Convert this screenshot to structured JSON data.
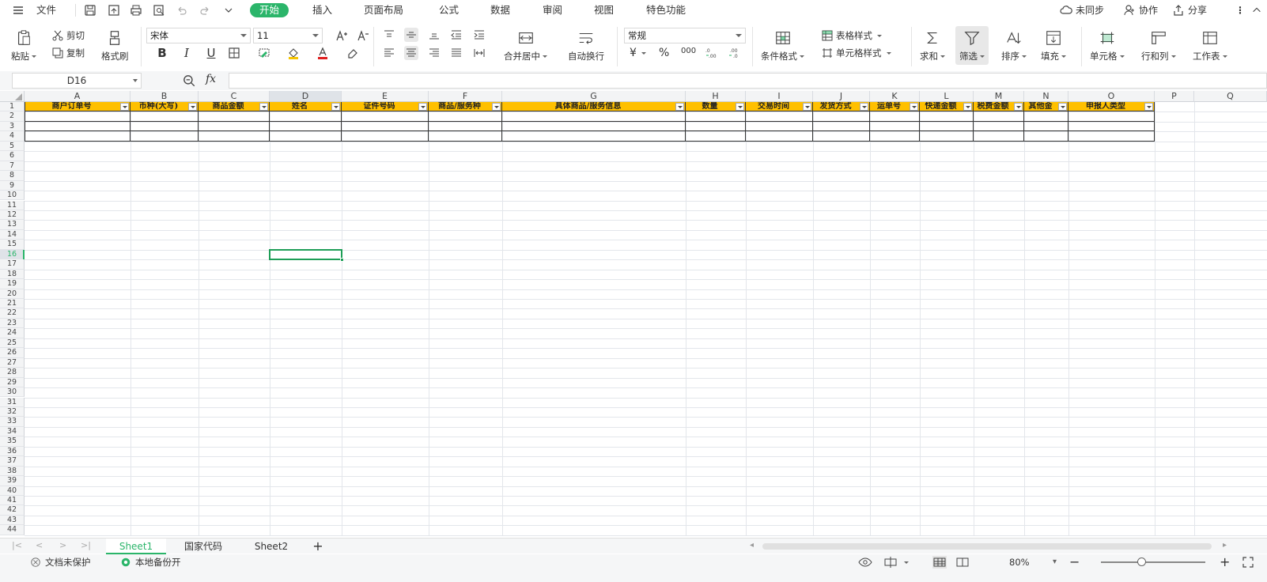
{
  "menubar": {
    "file_label": "文件",
    "tabs": [
      {
        "label": "开始",
        "active": true
      },
      {
        "label": "插入"
      },
      {
        "label": "页面布局"
      },
      {
        "label": "公式"
      },
      {
        "label": "数据"
      },
      {
        "label": "审阅"
      },
      {
        "label": "视图"
      },
      {
        "label": "特色功能"
      }
    ],
    "sync_label": "未同步",
    "collab_label": "协作",
    "share_label": "分享"
  },
  "ribbon": {
    "paste": "粘贴",
    "cut": "剪切",
    "copy": "复制",
    "format_painter": "格式刷",
    "font_name": "宋体",
    "font_size": "11",
    "merge_center": "合并居中",
    "wrap_text": "自动换行",
    "number_format": "常规",
    "cond_format": "条件格式",
    "table_style": "表格样式",
    "cell_style": "单元格样式",
    "sum": "求和",
    "filter": "筛选",
    "sort": "排序",
    "fill": "填充",
    "cell": "单元格",
    "row_col": "行和列",
    "worksheet": "工作表",
    "bold": "B",
    "italic": "I",
    "underline": "U",
    "currency": "¥",
    "percent": "%",
    "thousands": "000"
  },
  "formula_bar": {
    "name_box": "D16",
    "fx": "fx",
    "content": ""
  },
  "grid": {
    "columns": [
      "A",
      "B",
      "C",
      "D",
      "E",
      "F",
      "G",
      "H",
      "I",
      "J",
      "K",
      "L",
      "M",
      "N",
      "O",
      "P",
      "Q"
    ],
    "selected_column": "D",
    "selected_row": 16,
    "row_count": 44,
    "headers": [
      "商户订单号",
      "币种(大写)",
      "商品金额",
      "姓名",
      "证件号码",
      "商品/服务种类",
      "具体商品/服务信息",
      "数量",
      "交易时间",
      "发货方式",
      "运单号",
      "快递金额",
      "税费金额",
      "其他金",
      "申报人类型"
    ],
    "header_row_display": [
      "商户订单号",
      "币种(大写)",
      "商品金额",
      "姓名",
      "证件号码",
      "商品/服务种",
      "具体商品/服务信息",
      "数量",
      "交易时间",
      "发货方式",
      "运单号",
      "快递金额",
      "税费金额",
      "其他金",
      "申报人类型"
    ]
  },
  "sheets": {
    "tabs": [
      {
        "label": "Sheet1",
        "active": true
      },
      {
        "label": "国家代码"
      },
      {
        "label": "Sheet2"
      }
    ],
    "add_label": "+"
  },
  "status": {
    "protect": "文档未保护",
    "backup": "本地备份开",
    "zoom": "80%",
    "zoom_level_percent": 80,
    "accent": "#2bb56a",
    "header_fill": "#ffc000"
  }
}
